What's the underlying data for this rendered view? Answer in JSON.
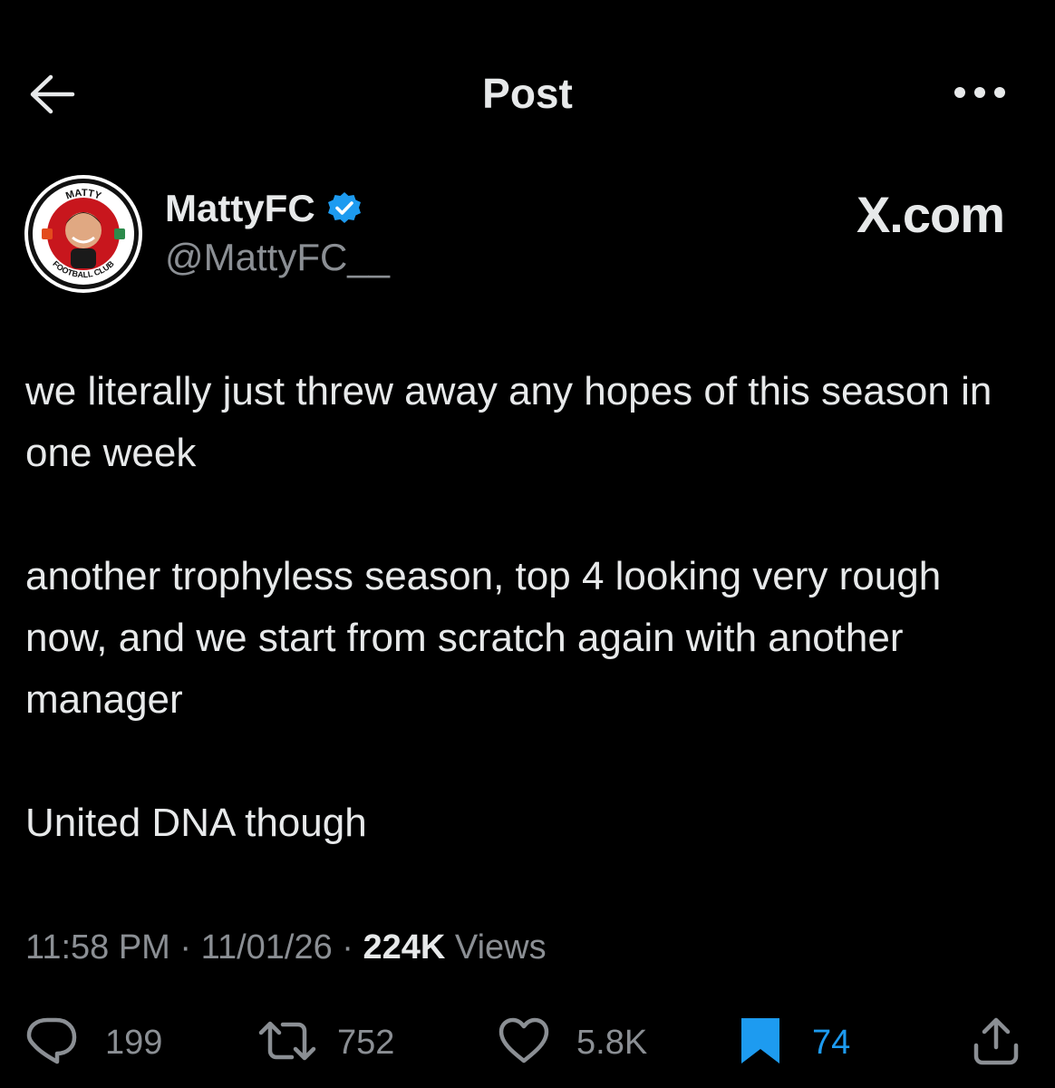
{
  "header": {
    "title": "Post",
    "back_icon": "arrow-left-icon",
    "more_icon": "more-horizontal-icon"
  },
  "author": {
    "name": "MattyFC",
    "handle": "@MattyFC__",
    "verified": true,
    "verified_color": "#1d9bf0",
    "avatar_top_text": "MATTY",
    "avatar_bottom_text": "FOOTBALL CLUB"
  },
  "watermark": "X.com",
  "post": {
    "paragraphs": [
      "we literally just threw away any hopes of this season in one week",
      "another trophyless season, top 4 looking very rough now, and we start from scratch again with another manager",
      "United DNA though"
    ]
  },
  "meta": {
    "time": "11:58 PM",
    "date": "11/01/26",
    "views_count": "224K",
    "views_label": "Views",
    "separator": "·"
  },
  "actions": {
    "replies": "199",
    "reposts": "752",
    "likes": "5.8K",
    "bookmarks": "74",
    "bookmarked": true,
    "accent_color": "#1d9bf0"
  }
}
